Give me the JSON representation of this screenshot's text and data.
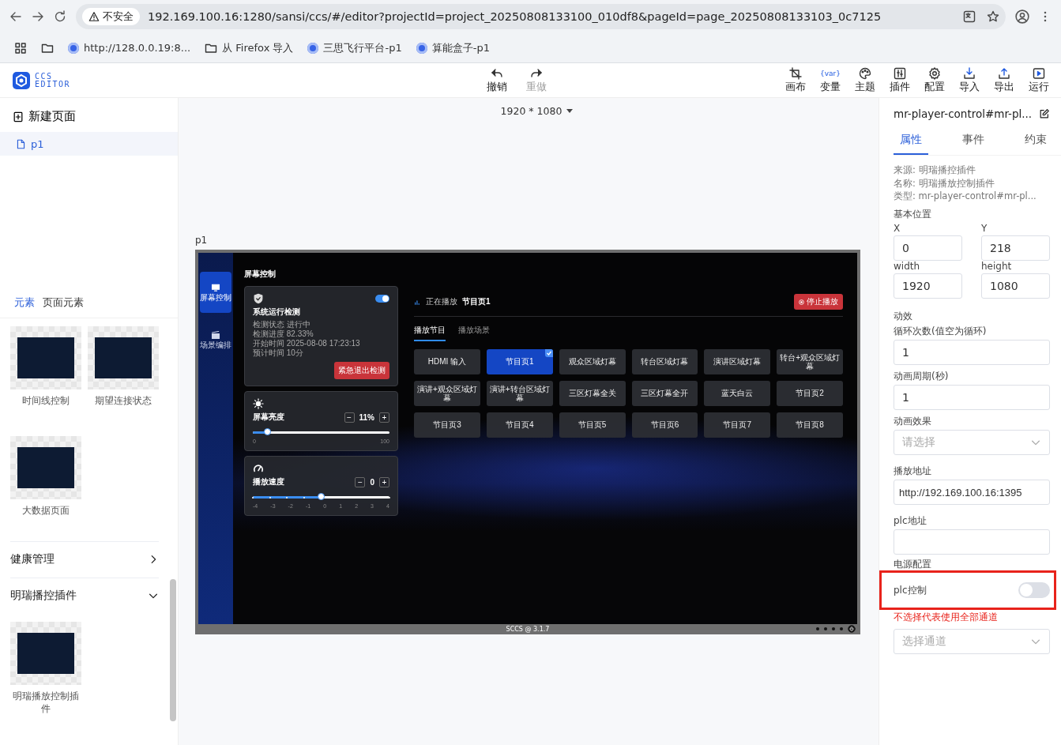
{
  "browser": {
    "security_label": "不安全",
    "address": "192.169.100.16:1280/sansi/ccs/#/editor?projectId=project_20250808133100_010df8&pageId=page_20250808133103_0c7125",
    "bookmarks": [
      {
        "kind": "site",
        "label": "http://128.0.0.19:8..."
      },
      {
        "kind": "folder",
        "label": "从 Firefox 导入"
      },
      {
        "kind": "site",
        "label": "三思飞行平台-p1"
      },
      {
        "kind": "site",
        "label": "算能盒子-p1"
      }
    ]
  },
  "header": {
    "logo_line1": "CCS",
    "logo_line2": "EDITOR",
    "history": [
      {
        "label": "撤销",
        "disabled": false
      },
      {
        "label": "重做",
        "disabled": true
      }
    ],
    "tools": [
      {
        "label": "画布"
      },
      {
        "label": "变量",
        "glyph": "{var}"
      },
      {
        "label": "主题"
      },
      {
        "label": "插件"
      },
      {
        "label": "配置"
      },
      {
        "label": "导入"
      },
      {
        "label": "导出"
      },
      {
        "label": "运行"
      }
    ]
  },
  "pages": {
    "new_label": "新建页面",
    "items": [
      {
        "name": "p1",
        "selected": true
      }
    ]
  },
  "library": {
    "tabs": [
      {
        "label": "元素",
        "selected": true
      },
      {
        "label": "页面元素",
        "selected": false
      }
    ],
    "items": [
      "时间线控制",
      "期望连接状态",
      "大数据页面"
    ],
    "groups": [
      {
        "title": "健康管理",
        "expanded": false
      },
      {
        "title": "明瑞播控插件",
        "expanded": true,
        "items": [
          "明瑞播放控制插件"
        ]
      }
    ]
  },
  "canvas": {
    "resolution": "1920 * 1080",
    "page_label": "p1",
    "preview": {
      "nav": [
        {
          "label": "屏幕控制",
          "selected": true
        },
        {
          "label": "场景编排",
          "selected": false
        }
      ],
      "title": "屏幕控制",
      "detection": {
        "on": true,
        "title": "系统运行检测",
        "lines": [
          "检测状态 进行中",
          "检测进度 82.33%",
          "开始时间 2025-08-08 17:23:13",
          "预计时间 10分"
        ],
        "button": "紧急退出检测"
      },
      "brightness": {
        "label": "屏幕亮度",
        "minus": "−",
        "plus": "+",
        "value": "11%",
        "level": 0.11,
        "scale": [
          "0",
          "100"
        ]
      },
      "speed": {
        "label": "播放速度",
        "minus": "−",
        "plus": "+",
        "value": "0",
        "level": 0.5,
        "scale": [
          "-4",
          "-3",
          "-2",
          "-1",
          "0",
          "1",
          "2",
          "3",
          "4"
        ]
      },
      "now_playing": {
        "label": "正在播放",
        "program": "节目页1",
        "stop": "停止播放"
      },
      "tabs": [
        {
          "label": "播放节目",
          "selected": true
        },
        {
          "label": "播放场景",
          "selected": false
        }
      ],
      "programs": [
        {
          "label": "HDMI 输入",
          "selected": false
        },
        {
          "label": "节目页1",
          "selected": true
        },
        {
          "label": "观众区域灯幕",
          "selected": false
        },
        {
          "label": "转台区域灯幕",
          "selected": false
        },
        {
          "label": "演讲区域灯幕",
          "selected": false
        },
        {
          "label": "转台+观众区域灯幕",
          "selected": false
        },
        {
          "label": "演讲+观众区域灯幕",
          "selected": false
        },
        {
          "label": "演讲+转台区域灯幕",
          "selected": false
        },
        {
          "label": "三区灯幕全关",
          "selected": false
        },
        {
          "label": "三区灯幕全开",
          "selected": false
        },
        {
          "label": "蓝天白云",
          "selected": false
        },
        {
          "label": "节目页2",
          "selected": false
        },
        {
          "label": "节目页3",
          "selected": false
        },
        {
          "label": "节目页4",
          "selected": false
        },
        {
          "label": "节目页5",
          "selected": false
        },
        {
          "label": "节目页6",
          "selected": false
        },
        {
          "label": "节目页7",
          "selected": false
        },
        {
          "label": "节目页8",
          "selected": false
        }
      ],
      "footer": "SCCS @ 3.1.7"
    }
  },
  "inspector": {
    "title": "mr-player-control#mr-pl...",
    "tabs": [
      {
        "label": "属性",
        "selected": true
      },
      {
        "label": "事件",
        "selected": false
      },
      {
        "label": "约束",
        "selected": false
      }
    ],
    "info": [
      "来源: 明瑞播控插件",
      "名称: 明瑞播放控制插件",
      "类型: mr-player-control#mr-pl..."
    ],
    "position_label": "基本位置",
    "position": [
      {
        "label": "X",
        "value": "0"
      },
      {
        "label": "Y",
        "value": "218"
      },
      {
        "label": "width",
        "value": "1920"
      },
      {
        "label": "height",
        "value": "1080"
      }
    ],
    "animation_label": "动效",
    "loop": {
      "label": "循环次数(值空为循环)",
      "value": "1"
    },
    "period": {
      "label": "动画周期(秒)",
      "value": "1"
    },
    "effect": {
      "label": "动画效果",
      "placeholder": "请选择"
    },
    "play_url": {
      "label": "播放地址",
      "value": "http://192.169.100.16:1395"
    },
    "plc_address": {
      "label": "plc地址"
    },
    "power_label": "电源配置",
    "plc_control": {
      "label": "plc控制",
      "on": false
    },
    "channel_hint": "不选择代表使用全部通道",
    "channel": {
      "placeholder": "选择通道"
    }
  }
}
